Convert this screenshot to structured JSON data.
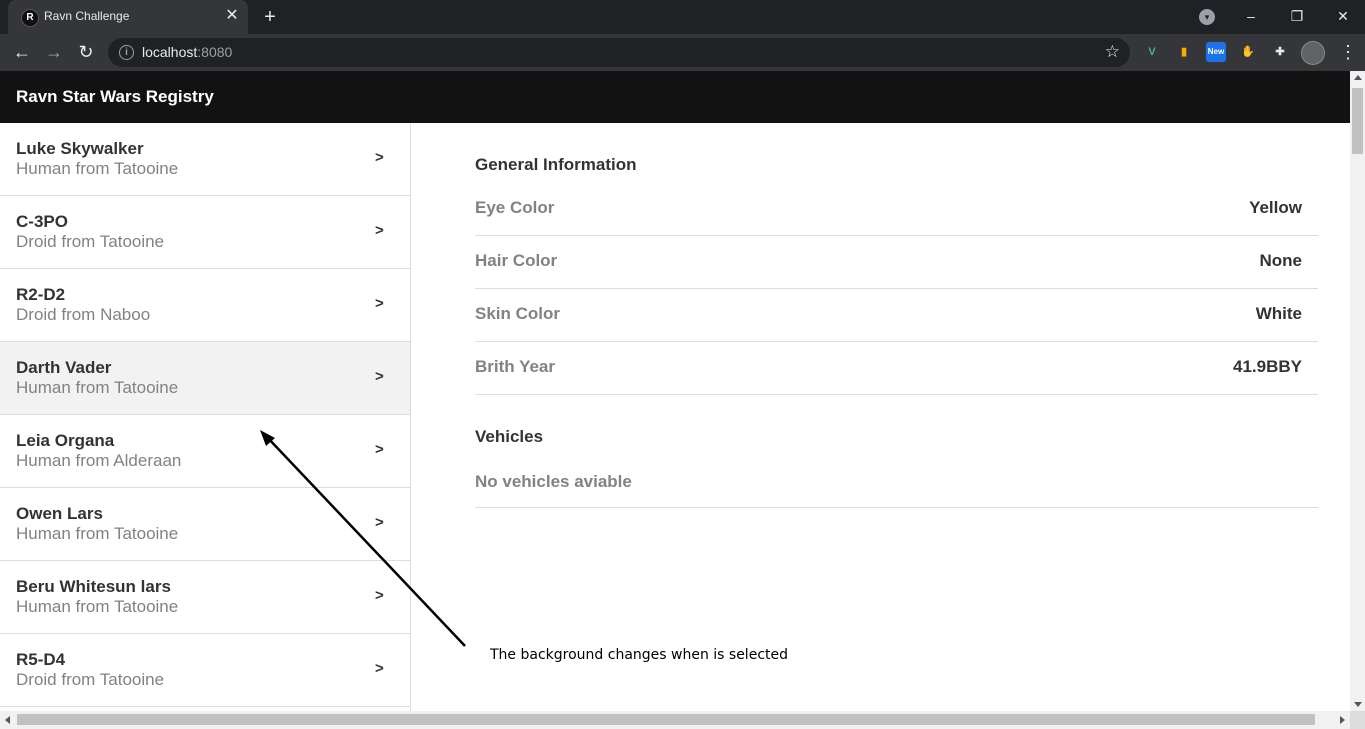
{
  "browser": {
    "tab_title": "Ravn Challenge",
    "tab_favicon": "R",
    "tab_close": "✕",
    "new_tab": "+",
    "url_host": "localhost",
    "url_port": ":8080",
    "extensions": [
      {
        "name": "vue-devtools-icon",
        "glyph": "V",
        "color": "#41b883"
      },
      {
        "name": "folder-extension-icon",
        "glyph": "▮",
        "color": "#f9ab00"
      },
      {
        "name": "new-extension-icon",
        "glyph": "New",
        "color": "#1a73e8"
      },
      {
        "name": "red-hand-extension-icon",
        "glyph": "✋",
        "color": "#ea4335"
      },
      {
        "name": "puzzle-icon",
        "glyph": "✚",
        "color": "#e8eaed"
      }
    ]
  },
  "app": {
    "title": "Ravn Star Wars Registry"
  },
  "people": [
    {
      "name": "Luke Skywalker",
      "subtitle": "Human from Tatooine",
      "selected": false
    },
    {
      "name": "C-3PO",
      "subtitle": "Droid from Tatooine",
      "selected": false
    },
    {
      "name": "R2-D2",
      "subtitle": "Droid from Naboo",
      "selected": false
    },
    {
      "name": "Darth Vader",
      "subtitle": "Human from Tatooine",
      "selected": true
    },
    {
      "name": "Leia Organa",
      "subtitle": "Human from Alderaan",
      "selected": false
    },
    {
      "name": "Owen Lars",
      "subtitle": "Human from Tatooine",
      "selected": false
    },
    {
      "name": "Beru Whitesun lars",
      "subtitle": "Human from Tatooine",
      "selected": false
    },
    {
      "name": "R5-D4",
      "subtitle": "Droid from Tatooine",
      "selected": false
    }
  ],
  "chevron": ">",
  "detail": {
    "general_title": "General Information",
    "rows": [
      {
        "label": "Eye Color",
        "value": "Yellow"
      },
      {
        "label": "Hair Color",
        "value": "None"
      },
      {
        "label": "Skin Color",
        "value": "White"
      },
      {
        "label": "Brith Year",
        "value": "41.9BBY"
      }
    ],
    "vehicles_title": "Vehicles",
    "no_vehicles": "No vehicles aviable"
  },
  "annotation": "The background changes when is selected"
}
